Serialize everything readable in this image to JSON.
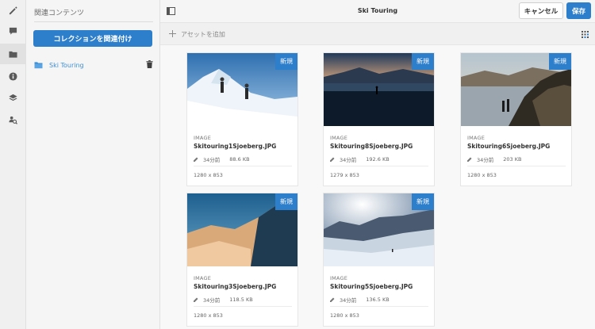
{
  "rail": {
    "items": [
      {
        "icon": "pencil-icon"
      },
      {
        "icon": "comment-icon"
      },
      {
        "icon": "folder-icon",
        "active": true
      },
      {
        "icon": "info-icon"
      },
      {
        "icon": "layers-icon"
      },
      {
        "icon": "search-people-icon"
      }
    ]
  },
  "panel": {
    "title": "関連コンテンツ",
    "relate_button": "コレクションを関連付け",
    "collection": "Ski Touring"
  },
  "header": {
    "title": "Ski Touring",
    "cancel_label": "キャンセル",
    "save_label": "保存"
  },
  "addbar": {
    "label": "アセットを追加"
  },
  "colors": {
    "accent": "#2d7ecb",
    "link": "#3d8fd5"
  },
  "assets": [
    {
      "badge": "新規",
      "type": "IMAGE",
      "name": "Skitouring1Sjoeberg.JPG",
      "time": "34分前",
      "size": "88.6 KB",
      "dims": "1280 x 853"
    },
    {
      "badge": "新規",
      "type": "IMAGE",
      "name": "Skitouring8Sjoeberg.JPG",
      "time": "34分前",
      "size": "192.6 KB",
      "dims": "1279 x 853"
    },
    {
      "badge": "新規",
      "type": "IMAGE",
      "name": "Skitouring6Sjoeberg.JPG",
      "time": "34分前",
      "size": "203 KB",
      "dims": "1280 x 853"
    },
    {
      "badge": "新規",
      "type": "IMAGE",
      "name": "Skitouring3Sjoeberg.JPG",
      "time": "34分前",
      "size": "118.5 KB",
      "dims": "1280 x 853"
    },
    {
      "badge": "新規",
      "type": "IMAGE",
      "name": "Skitouring5Sjoeberg.JPG",
      "time": "34分前",
      "size": "136.5 KB",
      "dims": "1280 x 853"
    }
  ]
}
